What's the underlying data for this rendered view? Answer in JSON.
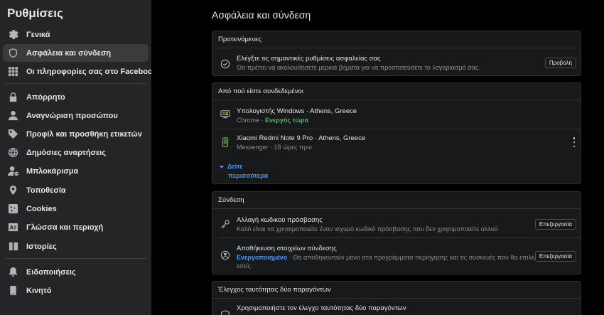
{
  "sidebar": {
    "title": "Ρυθμίσεις",
    "items": [
      {
        "label": "Γενικά"
      },
      {
        "label": "Ασφάλεια και σύνδεση"
      },
      {
        "label": "Οι πληροφορίες σας στο Facebook"
      },
      {
        "label": "Απόρρητο"
      },
      {
        "label": "Αναγνώριση προσώπου"
      },
      {
        "label": "Προφίλ και προσθήκη ετικετών"
      },
      {
        "label": "Δημόσιες αναρτήσεις"
      },
      {
        "label": "Μπλοκάρισμα"
      },
      {
        "label": "Τοποθεσία"
      },
      {
        "label": "Cookies"
      },
      {
        "label": "Γλώσσα και περιοχή"
      },
      {
        "label": "Ιστορίες"
      },
      {
        "label": "Ειδοποιήσεις"
      },
      {
        "label": "Κινητό"
      }
    ]
  },
  "main": {
    "title": "Ασφάλεια και σύνδεση",
    "recommended": {
      "heading": "Προτεινόμενες",
      "row_title": "Ελέγξτε τις σημαντικές ρυθμίσεις ασφαλείας σας",
      "row_sub": "Θα πρέπει να ακολουθήσετε μερικά βήματα για να προστατεύσετε το λογαριασμό σας.",
      "button": "Προβολή"
    },
    "where_logged_in": {
      "heading": "Από πού είστε συνδεδεμένοι",
      "sessions": [
        {
          "device": "Υπολογιστής Windows · Athens, Greece",
          "app": "Chrome · ",
          "status": "Ενεργός τώρα"
        },
        {
          "device": "Xiaomi Redmi Note 9 Pro · Athens, Greece",
          "app": "Messenger · 18 ώρες πριν",
          "status": ""
        }
      ],
      "see_more_1": "Δείτε",
      "see_more_2": "περισσότερα"
    },
    "login": {
      "heading": "Σύνδεση",
      "password_title": "Αλλαγή κωδικού πρόσβασης",
      "password_sub": "Καλό είναι να χρησιμοποιείτε έναν ισχυρό κωδικό πρόσβασης που δεν χρησιμοποιείτε αλλού",
      "password_button": "Επεξεργασία",
      "save_title": "Αποθήκευση στοιχείων σύνδεσης",
      "save_status": "Ενεργοποιημένο",
      "save_sub1": " · Θα αποθηκευτούν μόνο στα προγράμματα περιήγησης και τις συσκευές που θα επιλέξετε",
      "save_sub2": "εσείς",
      "save_button": "Επεξεργασία"
    },
    "two_factor": {
      "heading": "Έλεγχος ταυτότητας δύο παραγόντων",
      "row_title": "Χρησιμοποιήστε τον έλεγχο ταυτότητας δύο παραγόντων"
    }
  },
  "colors": {
    "sidebar_bg": "#242526",
    "card_bg": "#18191a",
    "active_green": "#45bd62",
    "link_blue": "#4599ff"
  }
}
